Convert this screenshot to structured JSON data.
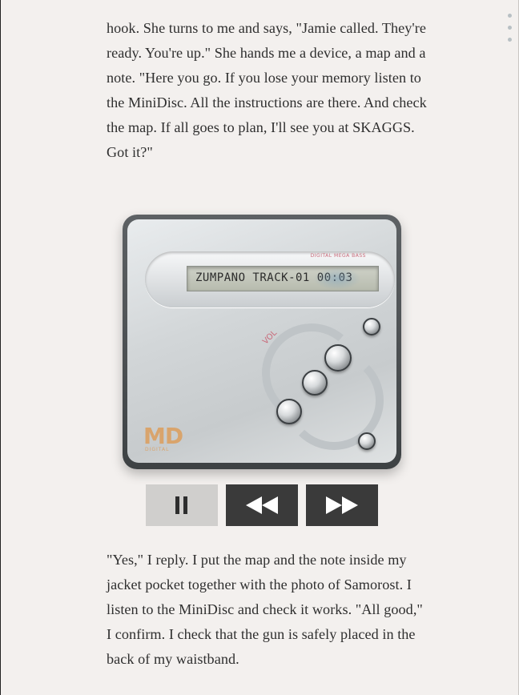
{
  "story": {
    "top_paragraph": "hook. She turns to me and says, \"Jamie called. They're ready. You're up.\" She hands me a device, a map and a note. \"Here you go. If you lose your memory listen to the MiniDisc. All the instructions are there. And check the map. If all goes to plan, I'll see you at SKAGGS. Got it?\"",
    "bottom_paragraph": "\"Yes,\" I reply. I put the map and the note inside my jacket pocket together with the photo of Samorost. I listen to the MiniDisc and check it works. \"All good,\" I confirm. I check that the gun is safely placed in the back of my waistband."
  },
  "device": {
    "display_text": "ZUMPANO TRACK-01 00:03",
    "brand_text": "DIGITAL MEGA BASS",
    "vol_label": "VOL",
    "logo_text": "MD",
    "logo_subtext": "DIGITAL"
  },
  "controls": {
    "pause_icon": "pause-icon",
    "rewind_icon": "rewind-icon",
    "forward_icon": "fast-forward-icon"
  },
  "colors": {
    "background": "#f3f0ee",
    "text": "#2f2f2f",
    "button_dark": "#3a3a3a",
    "button_light": "#d0cfcd"
  }
}
